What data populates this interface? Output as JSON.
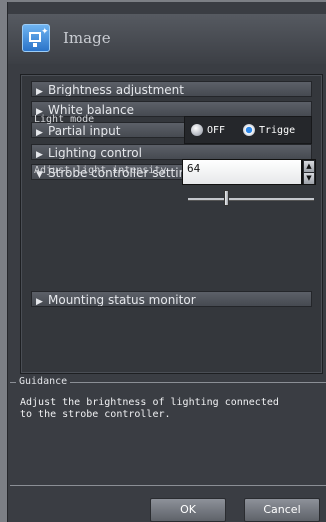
{
  "window": {
    "title": "Image"
  },
  "sections": [
    {
      "label": "Brightness adjustment",
      "arrow": "▶"
    },
    {
      "label": "White balance",
      "arrow": "▶"
    },
    {
      "label": "Partial input",
      "arrow": "▶"
    },
    {
      "label": "Lighting control",
      "arrow": "▶"
    },
    {
      "label": "Strobe controller settings",
      "arrow": "▼"
    },
    {
      "label": "Mounting status monitor",
      "arrow": "▶"
    }
  ],
  "strobe": {
    "light_mode_label": "Light mode",
    "light_mode_options": [
      "OFF",
      "Trigge"
    ],
    "light_mode_selected": "Trigge",
    "intensity_label": "Adjust light intensity",
    "intensity_value": "64",
    "spin_up": "▲",
    "spin_down": "▼"
  },
  "guidance": {
    "title": "Guidance",
    "text_line1": "Adjust the brightness of lighting connected",
    "text_line2": "to the strobe controller."
  },
  "buttons": {
    "ok": "OK",
    "cancel": "Cancel"
  }
}
